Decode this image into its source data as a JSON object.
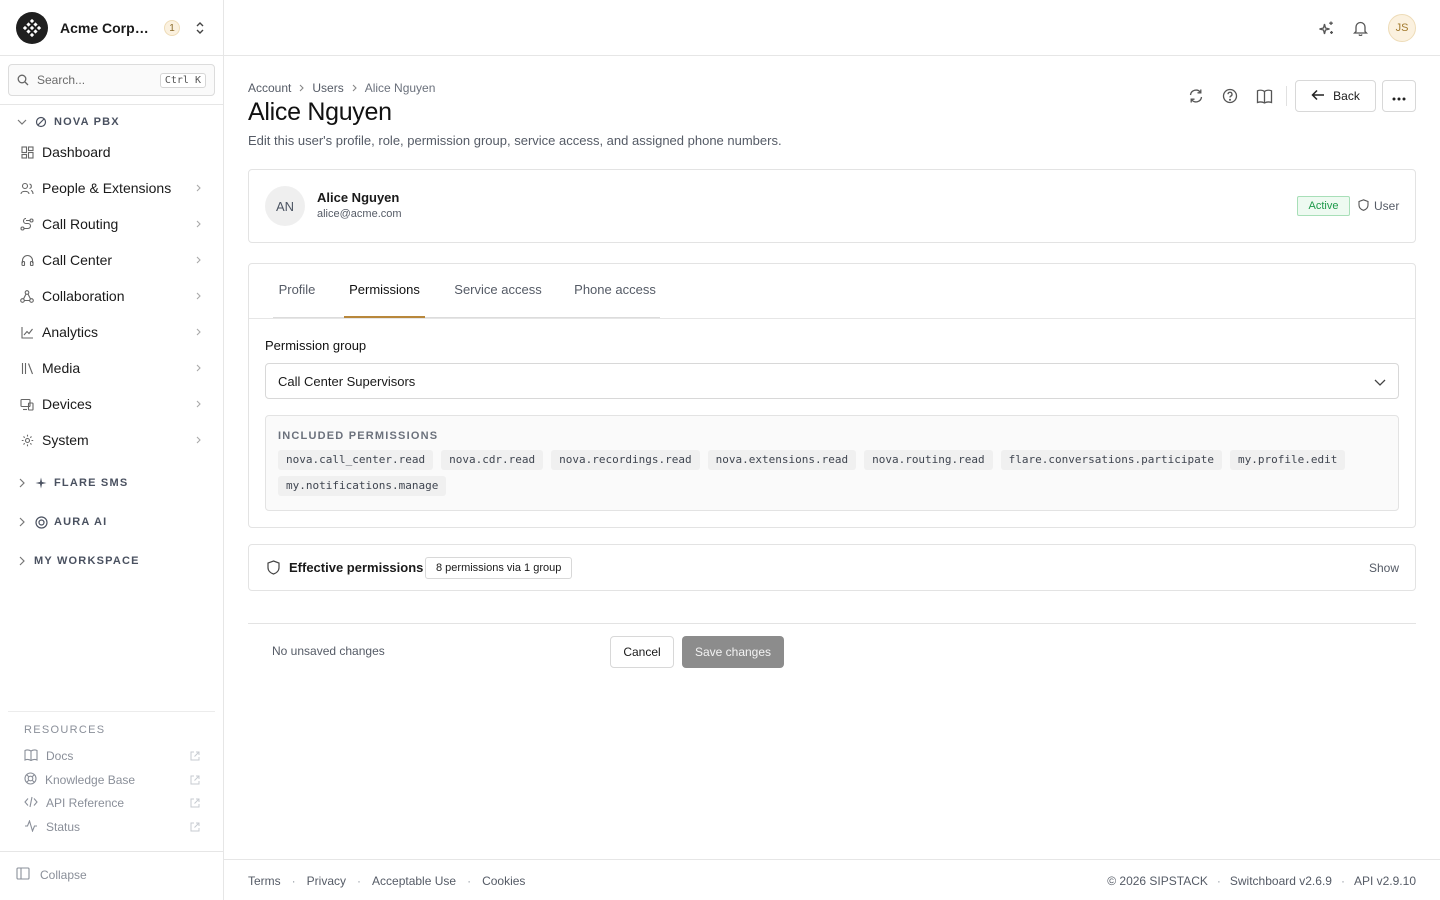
{
  "org": {
    "name": "Acme Corporation",
    "badge": "1"
  },
  "search": {
    "placeholder": "Search...",
    "shortcut": "Ctrl K"
  },
  "sidebar": {
    "nova_section": "NOVA PBX",
    "items": [
      {
        "label": "Dashboard",
        "icon": "dashboard-icon"
      },
      {
        "label": "People & Extensions",
        "icon": "people-icon"
      },
      {
        "label": "Call Routing",
        "icon": "routing-icon"
      },
      {
        "label": "Call Center",
        "icon": "headset-icon"
      },
      {
        "label": "Collaboration",
        "icon": "collaboration-icon"
      },
      {
        "label": "Analytics",
        "icon": "analytics-icon"
      },
      {
        "label": "Media",
        "icon": "media-icon"
      },
      {
        "label": "Devices",
        "icon": "devices-icon"
      },
      {
        "label": "System",
        "icon": "gear-icon"
      }
    ],
    "flare_section": "FLARE SMS",
    "aura_section": "AURA AI",
    "workspace_section": "MY WORKSPACE",
    "resources_head": "RESOURCES",
    "resources": [
      {
        "label": "Docs",
        "icon": "book-icon"
      },
      {
        "label": "Knowledge Base",
        "icon": "lifebuoy-icon"
      },
      {
        "label": "API Reference",
        "icon": "code-icon"
      },
      {
        "label": "Status",
        "icon": "activity-icon"
      }
    ],
    "collapse_label": "Collapse"
  },
  "topbar": {
    "avatar_initials": "JS"
  },
  "breadcrumb": [
    "Account",
    "Users",
    "Alice Nguyen"
  ],
  "page": {
    "title": "Alice Nguyen",
    "subtitle": "Edit this user's profile, role, permission group, service access, and assigned phone numbers."
  },
  "header_actions": {
    "back_label": "Back"
  },
  "user": {
    "initials": "AN",
    "name": "Alice Nguyen",
    "email": "alice@acme.com",
    "status": "Active",
    "role": "User"
  },
  "tabs": [
    "Profile",
    "Permissions",
    "Service access",
    "Phone access"
  ],
  "permissions": {
    "group_label": "Permission group",
    "group_value": "Call Center Supervisors",
    "included_head": "INCLUDED PERMISSIONS",
    "included": [
      "nova.call_center.read",
      "nova.cdr.read",
      "nova.recordings.read",
      "nova.extensions.read",
      "nova.routing.read",
      "flare.conversations.participate",
      "my.profile.edit",
      "my.notifications.manage"
    ]
  },
  "effective": {
    "title": "Effective permissions",
    "badge": "8 permissions via 1 group",
    "show_label": "Show"
  },
  "form": {
    "status": "No unsaved changes",
    "cancel_label": "Cancel",
    "save_label": "Save changes"
  },
  "footer": {
    "links": [
      "Terms",
      "Privacy",
      "Acceptable Use",
      "Cookies"
    ],
    "copyright": "© 2026 SIPSTACK",
    "version": "Switchboard v2.6.9",
    "api": "API v2.9.10"
  },
  "colors": {
    "accent_tab": "#b8873b",
    "status_active": "#1f9a4b",
    "save_disabled": "#8c8c8c"
  }
}
